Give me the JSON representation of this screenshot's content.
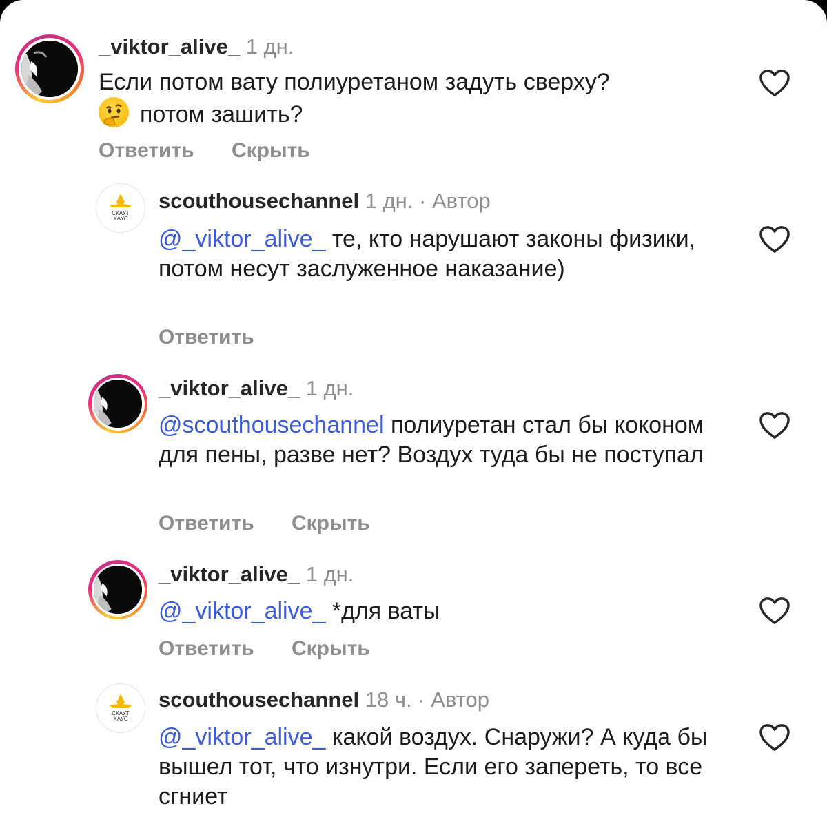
{
  "comments": [
    {
      "username": "_viktor_alive_",
      "time": "1 дн.",
      "author_tag": "",
      "mention": "",
      "text_line1": "Если потом вату полиуретаном задуть сверху?",
      "emoji": "thinking-face",
      "text_line2": "потом зашить?",
      "reply_label": "Ответить",
      "hide_label": "Скрыть"
    },
    {
      "username": "scouthousechannel",
      "time": "1 дн.",
      "author_tag": "· Автор",
      "avatar_text": [
        "СКАУТ",
        "ХАУС"
      ],
      "mention": "@_viktor_alive_",
      "text": "те, кто нарушают законы физики, потом несут заслуженное наказание)",
      "reply_label": "Ответить"
    },
    {
      "username": "_viktor_alive_",
      "time": "1 дн.",
      "author_tag": "",
      "mention": "@scouthousechannel",
      "text": "полиуретан стал бы коконом для пены, разве нет? Воздух туда бы не поступал",
      "reply_label": "Ответить",
      "hide_label": "Скрыть"
    },
    {
      "username": "_viktor_alive_",
      "time": "1 дн.",
      "author_tag": "",
      "mention": "@_viktor_alive_",
      "text": "*для ваты",
      "reply_label": "Ответить",
      "hide_label": "Скрыть"
    },
    {
      "username": "scouthousechannel",
      "time": "18 ч.",
      "author_tag": "· Автор",
      "avatar_text": [
        "СКАУТ",
        "ХАУС"
      ],
      "mention": "@_viktor_alive_",
      "text": "какой воздух. Снаружи? А куда бы вышел тот, что изнутри. Если его запереть, то все сгниет"
    }
  ],
  "colors": {
    "mention": "#3b5bdb",
    "username": "#262626",
    "meta": "#8e8e8e",
    "logo_yellow": "#f5b800"
  },
  "icons": {
    "like": "heart-outline-icon"
  }
}
